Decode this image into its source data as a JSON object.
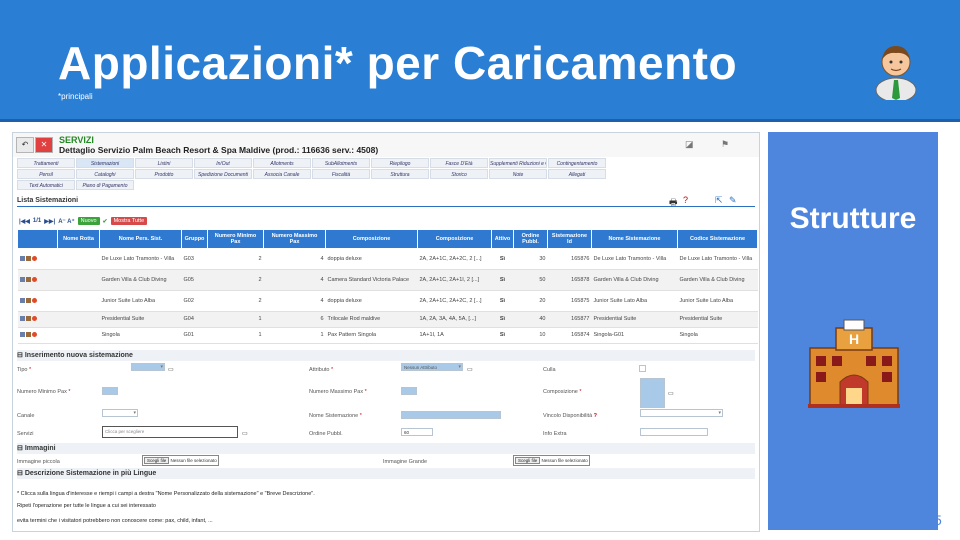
{
  "slide": {
    "title": "Applicazioni* per Caricamento",
    "subtitle": "*principali",
    "side_title": "Strutture",
    "slide_number": "5"
  },
  "colors": {
    "header": "#2a7fd4",
    "side_panel": "#4f86dd",
    "table_header": "#2f7ad0"
  },
  "app": {
    "section": "SERVIZI",
    "detail": "Dettaglio Servizio Palm Beach Resort & Spa Maldive (prod.: 116636 serv.: 4508)",
    "menu_row1": [
      "Trattamenti",
      "Sistemazioni",
      "Listini",
      "In/Out",
      "Allotments",
      "SubAllotments",
      "Riepilogo",
      "Fasce D'Età",
      "Supplementi Riduzioni e Offerte",
      "Contingentamento"
    ],
    "menu_row2": [
      "Pensil",
      "Cataloghi",
      "Prodotto",
      "Spedizione Documenti",
      "Associa Canale",
      "Fiscalità",
      "Struttura",
      "Storico",
      "Note",
      "Allegati"
    ],
    "menu_row3": [
      "Text Automatici",
      "Piano di Pagamento"
    ],
    "list_title": "Lista Sistemazioni",
    "pager": "1/1",
    "btn_new": "Nuovo",
    "btn_show_all": "Mostra Tutte",
    "columns": [
      "Nome Rotta",
      "Nome Pers. Sist.",
      "Gruppo",
      "Numero Minimo Pax",
      "Numero Massimo Pax",
      "Composizione",
      "Composizione",
      "Attivo",
      "Ordine Pubbl.",
      "Sistemazione Id",
      "Nome Sistemazione",
      "Codice Sistemazione"
    ],
    "rows": [
      {
        "nome_pers": "De Luxe Lato Tramonto - Villa",
        "gruppo": "G03",
        "min": "2",
        "max": "4",
        "comp1": "doppia deluxe",
        "comp2": "2A, 2A+1C, 2A+2C, 2 [...]",
        "attivo": "Sì",
        "ordine": "30",
        "id": "165876",
        "nome_sist": "De Luxe Lato Tramonto - Villa",
        "codice": "De Luxe Lato Tramonto - Villa"
      },
      {
        "nome_pers": "Garden Villa & Club Diving",
        "gruppo": "G05",
        "min": "2",
        "max": "4",
        "comp1": "Camera Standard Victoria Palace",
        "comp2": "2A, 2A+1C, 2A+1I, 2 [...]",
        "attivo": "Sì",
        "ordine": "50",
        "id": "165878",
        "nome_sist": "Garden Villa & Club Diving",
        "codice": "Garden Villa & Club Diving"
      },
      {
        "nome_pers": "Junior Suite Lato Alba",
        "gruppo": "G02",
        "min": "2",
        "max": "4",
        "comp1": "doppia deluxe",
        "comp2": "2A, 2A+1C, 2A+2C, 2 [...]",
        "attivo": "Sì",
        "ordine": "20",
        "id": "165875",
        "nome_sist": "Junior Suite Lato Alba",
        "codice": "Junior Suite Lato Alba"
      },
      {
        "nome_pers": "Presidential Suite",
        "gruppo": "G04",
        "min": "1",
        "max": "6",
        "comp1": "Trilocale Rod maldive",
        "comp2": "1A, 2A, 3A, 4A, 5A, [...]",
        "attivo": "Sì",
        "ordine": "40",
        "id": "165877",
        "nome_sist": "Presidential Suite",
        "codice": "Presidential Suite"
      },
      {
        "nome_pers": "Singola",
        "gruppo": "G01",
        "min": "1",
        "max": "1",
        "comp1": "Pax Pattern Singola",
        "comp2": "1A+1I, 1A",
        "attivo": "Sì",
        "ordine": "10",
        "id": "165874",
        "nome_sist": "Singola-G01",
        "codice": "Singola"
      }
    ],
    "insert_title": "Inserimento nuova sistemazione",
    "form": {
      "tipo": "Tipo",
      "attributo": "Attributo",
      "attributo_value": "Nessun Attributo",
      "culla": "Culla",
      "min_pax": "Numero Minimo Pax",
      "max_pax": "Numero Massimo Pax",
      "composizione": "Composizione",
      "canale": "Canale",
      "nome_sist": "Nome Sistemazione",
      "vincolo": "Vincolo Disponibilità",
      "servizi": "Servizi",
      "servizi_placeholder": "Clicca per scegliere",
      "ordine": "Ordine Pubbl.",
      "ordine_value": "60",
      "info_extra": "Info Extra"
    },
    "images_title": "Immagini",
    "img_small": "Immagine piccola",
    "img_large": "Immagine Grande",
    "file_btn": "Scegli file",
    "file_none": "Nessun file selezionato",
    "desc_title": "Descrizione Sistemazione in più Lingue",
    "note1": "* Clicca sulla lingua d'interesse e riempi i campi a destra \"Nome Personalizzato della sistemazione\" e \"Breve Descrizione\".",
    "note2": "Ripeti l'operazione per tutte le lingue a cui sei interessato",
    "note3": "evita termini che i visitatori potrebbero non conoscere come: pax, child, infant, ..."
  }
}
